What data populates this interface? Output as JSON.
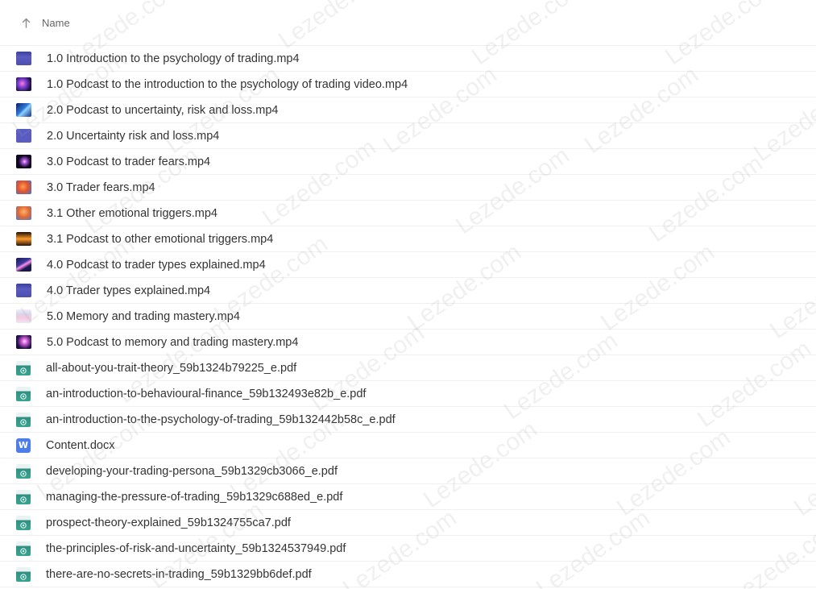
{
  "header": {
    "sort_icon": "arrow-up-icon",
    "column_label": "Name"
  },
  "files": [
    {
      "name": "1.0 Introduction to the psychology of trading.mp4",
      "icon": "video-thumbnail-icon",
      "thumb": "slide"
    },
    {
      "name": "1.0 Podcast to the introduction to the psychology of trading video.mp4",
      "icon": "video-thumbnail-icon",
      "thumb": "nebula"
    },
    {
      "name": "2.0 Podcast to uncertainty, risk and loss.mp4",
      "icon": "video-thumbnail-icon",
      "thumb": "bluewave"
    },
    {
      "name": "2.0 Uncertainty risk and loss.mp4",
      "icon": "video-thumbnail-icon",
      "thumb": "plainblue"
    },
    {
      "name": "3.0 Podcast to trader fears.mp4",
      "icon": "video-thumbnail-icon",
      "thumb": "dark"
    },
    {
      "name": "3.0 Trader fears.mp4",
      "icon": "video-thumbnail-icon",
      "thumb": "orange"
    },
    {
      "name": "3.1 Other emotional triggers.mp4",
      "icon": "video-thumbnail-icon",
      "thumb": "orange2"
    },
    {
      "name": "3.1 Podcast to other emotional triggers.mp4",
      "icon": "video-thumbnail-icon",
      "thumb": "fire"
    },
    {
      "name": "4.0 Podcast to trader types explained.mp4",
      "icon": "video-thumbnail-icon",
      "thumb": "streak"
    },
    {
      "name": "4.0 Trader types explained.mp4",
      "icon": "video-thumbnail-icon",
      "thumb": "slide"
    },
    {
      "name": "5.0 Memory and trading mastery.mp4",
      "icon": "video-thumbnail-icon",
      "thumb": "light"
    },
    {
      "name": "5.0 Podcast to memory and trading mastery.mp4",
      "icon": "video-thumbnail-icon",
      "thumb": "nebula2"
    },
    {
      "name": "all-about-you-trait-theory_59b1324b79225_e.pdf",
      "icon": "pdf-thumbnail-icon",
      "thumb": "pdf"
    },
    {
      "name": "an-introduction-to-behavioural-finance_59b132493e82b_e.pdf",
      "icon": "pdf-thumbnail-icon",
      "thumb": "pdf"
    },
    {
      "name": "an-introduction-to-the-psychology-of-trading_59b132442b58c_e.pdf",
      "icon": "pdf-thumbnail-icon",
      "thumb": "pdf"
    },
    {
      "name": "Content.docx",
      "icon": "word-document-icon",
      "thumb": "doc"
    },
    {
      "name": "developing-your-trading-persona_59b1329cb3066_e.pdf",
      "icon": "pdf-thumbnail-icon",
      "thumb": "pdf"
    },
    {
      "name": "managing-the-pressure-of-trading_59b1329c688ed_e.pdf",
      "icon": "pdf-thumbnail-icon",
      "thumb": "pdf"
    },
    {
      "name": "prospect-theory-explained_59b1324755ca7.pdf",
      "icon": "pdf-thumbnail-icon",
      "thumb": "pdf"
    },
    {
      "name": "the-principles-of-risk-and-uncertainty_59b1324537949.pdf",
      "icon": "pdf-thumbnail-icon",
      "thumb": "pdf"
    },
    {
      "name": "there-are-no-secrets-in-trading_59b1329bb6def.pdf",
      "icon": "pdf-thumbnail-icon",
      "thumb": "pdf"
    }
  ],
  "doc_icon_letter": "W",
  "watermark_text": "Lezede.com"
}
